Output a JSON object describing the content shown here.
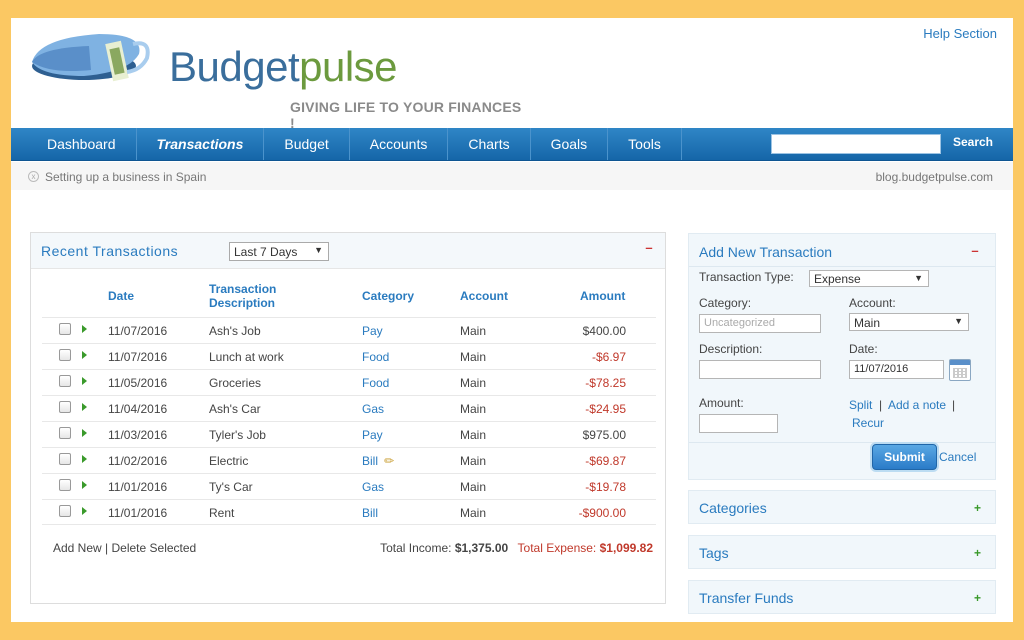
{
  "header": {
    "help_link": "Help Section",
    "brand_part1": "Budget",
    "brand_part2": "pulse",
    "tagline": "GIVING LIFE TO YOUR FINANCES !"
  },
  "nav": {
    "items": [
      {
        "label": "Dashboard",
        "active": false
      },
      {
        "label": "Transactions",
        "active": true
      },
      {
        "label": "Budget",
        "active": false
      },
      {
        "label": "Accounts",
        "active": false
      },
      {
        "label": "Charts",
        "active": false
      },
      {
        "label": "Goals",
        "active": false
      },
      {
        "label": "Tools",
        "active": false
      }
    ],
    "search_value": "",
    "search_button": "Search"
  },
  "ticker": {
    "news": "Setting up a business in Spain",
    "blog": "blog.budgetpulse.com"
  },
  "recent": {
    "title": "Recent Transactions",
    "period": "Last 7 Days",
    "collapse": "–",
    "columns": {
      "date": "Date",
      "desc_line1": "Transaction",
      "desc_line2": "Description",
      "category": "Category",
      "account": "Account",
      "amount": "Amount"
    },
    "rows": [
      {
        "date": "11/07/2016",
        "desc": "Ash's Job",
        "category": "Pay",
        "account": "Main",
        "amount": "$400.00",
        "negative": false
      },
      {
        "date": "11/07/2016",
        "desc": "Lunch at work",
        "category": "Food",
        "account": "Main",
        "amount": "-$6.97",
        "negative": true
      },
      {
        "date": "11/05/2016",
        "desc": "Groceries",
        "category": "Food",
        "account": "Main",
        "amount": "-$78.25",
        "negative": true
      },
      {
        "date": "11/04/2016",
        "desc": "Ash's Car",
        "category": "Gas",
        "account": "Main",
        "amount": "-$24.95",
        "negative": true
      },
      {
        "date": "11/03/2016",
        "desc": "Tyler's Job",
        "category": "Pay",
        "account": "Main",
        "amount": "$975.00",
        "negative": false
      },
      {
        "date": "11/02/2016",
        "desc": "Electric",
        "category": "Bill",
        "account": "Main",
        "amount": "-$69.87",
        "negative": true,
        "editing": true
      },
      {
        "date": "11/01/2016",
        "desc": "Ty's Car",
        "category": "Gas",
        "account": "Main",
        "amount": "-$19.78",
        "negative": true
      },
      {
        "date": "11/01/2016",
        "desc": "Rent",
        "category": "Bill",
        "account": "Main",
        "amount": "-$900.00",
        "negative": true
      }
    ],
    "footer": {
      "add_new": "Add New",
      "sep": " | ",
      "delete_selected": "Delete Selected",
      "income_label": "Total Income:",
      "income_value": "$1,375.00",
      "expense_label": "Total Expense:",
      "expense_value": "$1,099.82"
    }
  },
  "add_transaction": {
    "title": "Add New Transaction",
    "collapse": "–",
    "type_label": "Transaction Type:",
    "type_value": "Expense",
    "category_label": "Category:",
    "category_placeholder": "Uncategorized",
    "account_label": "Account:",
    "account_value": "Main",
    "description_label": "Description:",
    "description_value": "",
    "date_label": "Date:",
    "date_value": "11/07/2016",
    "amount_label": "Amount:",
    "amount_value": "",
    "split": "Split",
    "add_note": "Add a note",
    "recur": "Recur",
    "pipe": "|",
    "submit": "Submit",
    "cancel": "Cancel"
  },
  "side_boxes": [
    {
      "label": "Categories",
      "toggle": "+"
    },
    {
      "label": "Tags",
      "toggle": "+"
    },
    {
      "label": "Transfer Funds",
      "toggle": "+"
    }
  ],
  "colors": {
    "nav_blue": "#1f74b8",
    "link_blue": "#2a7bbf",
    "negative_red": "#c0392b",
    "border_yellow": "#fbc863",
    "brand_green": "#6c9a3e"
  }
}
